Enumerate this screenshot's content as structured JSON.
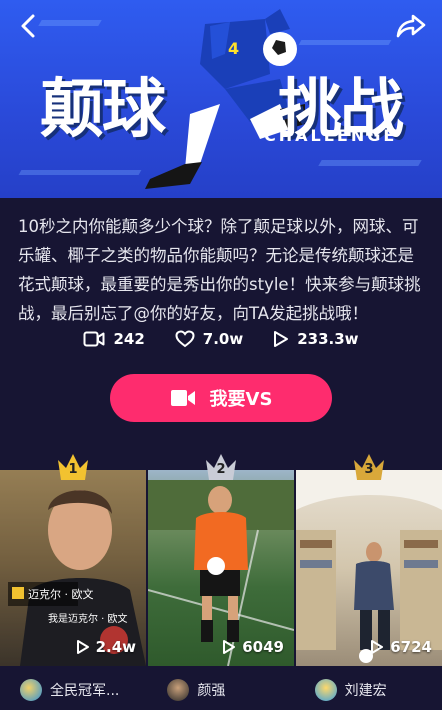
{
  "banner": {
    "title": "颠球挑战",
    "subtitle": "CHALLENGE",
    "back_icon": "chevron-left-icon",
    "share_icon": "share-arrow-icon"
  },
  "description": "10秒之内你能颠多少个球？除了颠足球以外，网球、可乐罐、椰子之类的物品你能颠吗？无论是传统颠球还是花式颠球，最重要的是秀出你的style！快来参与颠球挑战，最后别忘了@你的好友，向TA发起挑战哦！",
  "stats": {
    "videos": "242",
    "likes": "7.0w",
    "plays": "233.3w"
  },
  "vs_button": {
    "label": "我要VS",
    "color": "#fe2c6e"
  },
  "videos": [
    {
      "rank": "1",
      "crown_color": "#f2c230",
      "count": "2.4w",
      "caption_name": "迈克尔 · 欧文",
      "caption_line": "我是迈克尔 · 欧文"
    },
    {
      "rank": "2",
      "crown_color": "#c9ccd6",
      "count": "6049"
    },
    {
      "rank": "3",
      "crown_color": "#d9a83a",
      "count": "6724"
    }
  ],
  "users": [
    {
      "name": "全民冠军..."
    },
    {
      "name": "颜强"
    },
    {
      "name": "刘建宏"
    }
  ]
}
